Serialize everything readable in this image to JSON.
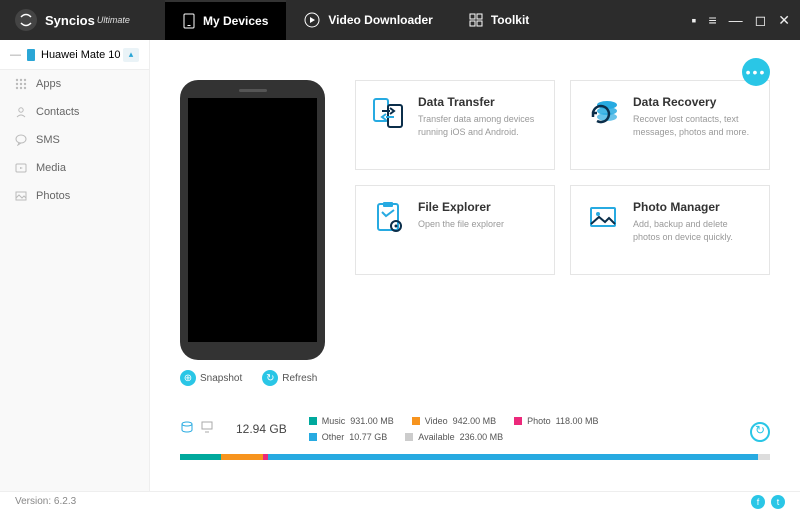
{
  "app": {
    "name": "Syncios",
    "edition": "Ultimate"
  },
  "tabs": [
    {
      "label": "My Devices"
    },
    {
      "label": "Video Downloader"
    },
    {
      "label": "Toolkit"
    }
  ],
  "device": {
    "name": "Huawei Mate 10"
  },
  "sidebar": [
    {
      "label": "Apps"
    },
    {
      "label": "Contacts"
    },
    {
      "label": "SMS"
    },
    {
      "label": "Media"
    },
    {
      "label": "Photos"
    }
  ],
  "phone_actions": {
    "snapshot": "Snapshot",
    "refresh": "Refresh"
  },
  "cards": [
    {
      "title": "Data Transfer",
      "desc": "Transfer data among devices running iOS and Android."
    },
    {
      "title": "Data Recovery",
      "desc": "Recover lost contacts, text messages, photos and more."
    },
    {
      "title": "File Explorer",
      "desc": "Open the file explorer"
    },
    {
      "title": "Photo Manager",
      "desc": "Add, backup and delete photos on device quickly."
    }
  ],
  "storage": {
    "total": "12.94 GB",
    "legend": [
      {
        "label": "Music",
        "value": "931.00 MB",
        "color": "#00a99d"
      },
      {
        "label": "Video",
        "value": "942.00 MB",
        "color": "#f7941e"
      },
      {
        "label": "Photo",
        "value": "118.00 MB",
        "color": "#ec297b"
      },
      {
        "label": "Other",
        "value": "10.77 GB",
        "color": "#27aae1"
      },
      {
        "label": "Available",
        "value": "236.00 MB",
        "color": "#cccccc"
      }
    ]
  },
  "footer": {
    "version_label": "Version:",
    "version": "6.2.3"
  }
}
